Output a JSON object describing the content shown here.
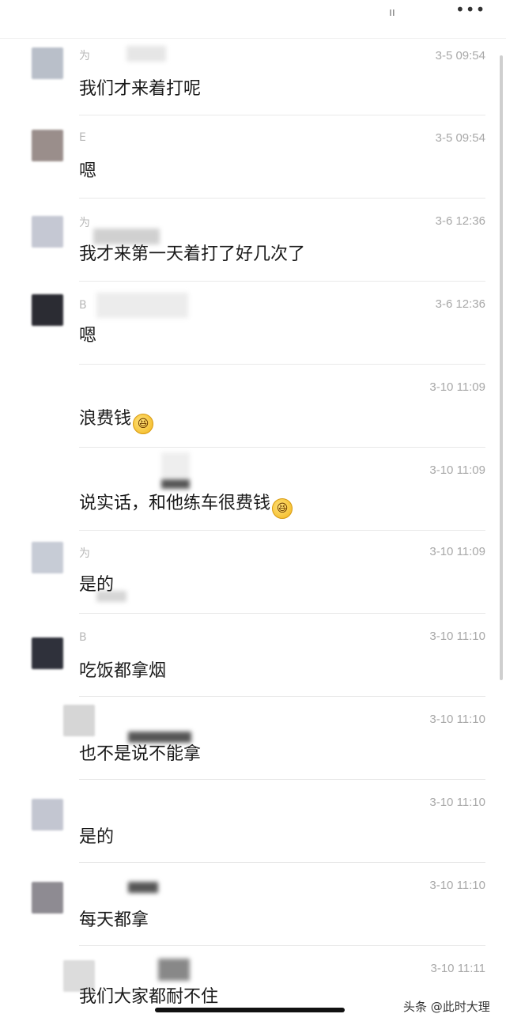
{
  "header": {
    "top_glyph": "ıı",
    "more_icon": "•••"
  },
  "messages": [
    {
      "sender": "为",
      "time": "3-5 09:54",
      "text": "我们才来着打呢",
      "avatar_color": "#b9bfc9",
      "emoji": false
    },
    {
      "sender": "E",
      "time": "3-5 09:54",
      "text": "嗯",
      "avatar_color": "#9a8e8b",
      "emoji": false
    },
    {
      "sender": "为",
      "time": "3-6 12:36",
      "text": "我才来第一天着打了好几次了",
      "avatar_color": "#c5c8d3",
      "emoji": false
    },
    {
      "sender": "B",
      "time": "3-6 12:36",
      "text": "嗯",
      "avatar_color": "#2b2c33",
      "emoji": false
    },
    {
      "sender": "",
      "time": "3-10 11:09",
      "text": "浪费钱",
      "avatar_color": "",
      "emoji": true
    },
    {
      "sender": "",
      "time": "3-10 11:09",
      "text": "说实话，和他练车很费钱",
      "avatar_color": "",
      "emoji": true
    },
    {
      "sender": "为",
      "time": "3-10 11:09",
      "text": "是的",
      "avatar_color": "#c7ccd6",
      "emoji": false
    },
    {
      "sender": "B",
      "time": "3-10 11:10",
      "text": "吃饭都拿烟",
      "avatar_color": "#2f313b",
      "emoji": false
    },
    {
      "sender": "",
      "time": "3-10 11:10",
      "text": "也不是说不能拿",
      "avatar_color": "#d6d6d6",
      "emoji": false
    },
    {
      "sender": "",
      "time": "3-10 11:10",
      "text": "是的",
      "avatar_color": "#c3c6d1",
      "emoji": false
    },
    {
      "sender": "",
      "time": "3-10 11:10",
      "text": "每天都拿",
      "avatar_color": "#8e8b92",
      "emoji": false
    },
    {
      "sender": "",
      "time": "3-10 11:11",
      "text": "我们大家都耐不住",
      "avatar_color": "#dcdcdc",
      "emoji": false
    }
  ],
  "emoji_glyph": "😆",
  "watermark": "头条 @此时大理"
}
